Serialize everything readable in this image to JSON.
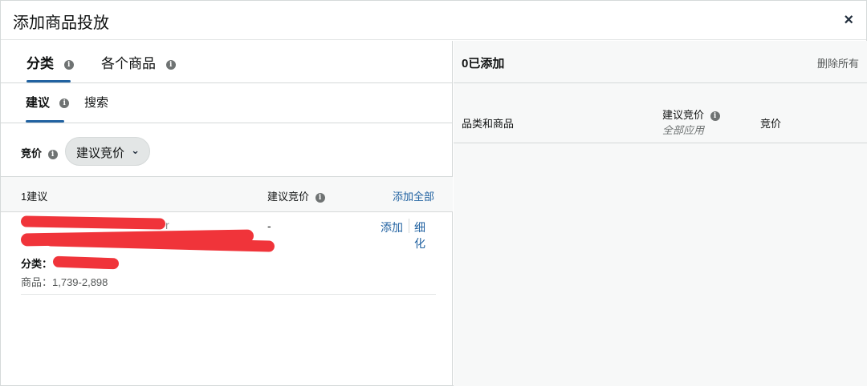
{
  "modal": {
    "title": "添加商品投放",
    "close_label": "×"
  },
  "tabs": {
    "category": "分类",
    "individual": "各个商品"
  },
  "subtabs": {
    "suggested": "建议",
    "search": "搜索"
  },
  "bid": {
    "label": "竞价",
    "dropdown_value": "建议竞价",
    "chevron": "⌄"
  },
  "table": {
    "count_label": "1建议",
    "bid_header": "建议竞价",
    "add_all": "添加全部"
  },
  "suggestion": {
    "title_tail": "r",
    "bid": "-",
    "add": "添加",
    "refine": "细化",
    "category_label": "分类：",
    "products_label": "商品：1,739-2,898"
  },
  "right": {
    "count": "0已添加",
    "clear_all": "删除所有",
    "col_category": "品类和商品",
    "col_bid": "建议竞价",
    "col_apply": "全部应用",
    "col_price": "竞价"
  },
  "icons": {
    "info": "i"
  },
  "colors": {
    "link": "#2162a1",
    "tab_underline": "#2162a1",
    "redaction": "#f0343a"
  }
}
